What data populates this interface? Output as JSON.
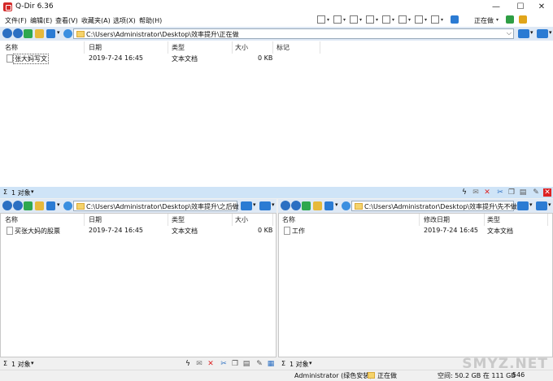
{
  "window": {
    "title": "Q-Dir 6.36"
  },
  "menu": [
    "文件(F)",
    "编辑(E)",
    "查看(V)",
    "收藏夹(A)",
    "选项(X)",
    "帮助(H)"
  ],
  "quick_view": {
    "label": "正在做"
  },
  "columns": {
    "name": "名称",
    "date": "日期",
    "type": "类型",
    "size": "大小",
    "tag": "标记",
    "modified": "修改日期"
  },
  "pane_top": {
    "path": "C:\\Users\\Administrator\\Desktop\\效率提升\\正在做",
    "files": [
      {
        "name": "张大妈写文",
        "date": "2019-7-24 16:45",
        "type": "文本文档",
        "size": "0 KB"
      }
    ],
    "status": "1 对象"
  },
  "pane_left": {
    "path": "C:\\Users\\Administrator\\Desktop\\效率提升\\之后做",
    "files": [
      {
        "name": "买张大妈的股票",
        "date": "2019-7-24 16:45",
        "type": "文本文档",
        "size": "0 KB"
      }
    ],
    "status": "1 对象"
  },
  "pane_right": {
    "path": "C:\\Users\\Administrator\\Desktop\\效率提升\\先不做",
    "files": [
      {
        "name": "工作",
        "date": "2019-7-24 16:45",
        "type": "文本文档"
      }
    ],
    "status": "1 对象"
  },
  "statusbar": {
    "user": "Administrator (绿色安装)",
    "folder": "正在做",
    "space": "空间: 50.2 GB 在 111 GB",
    "count": "546"
  },
  "watermark": "SMYZ.NET"
}
